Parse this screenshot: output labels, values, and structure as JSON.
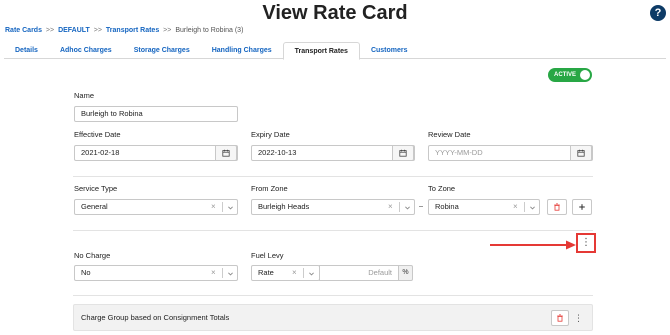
{
  "header": {
    "title": "View Rate Card",
    "help_icon_text": "?"
  },
  "breadcrumb": [
    {
      "label": "Rate Cards",
      "link": true
    },
    {
      "label": "DEFAULT",
      "link": true
    },
    {
      "label": "Transport Rates",
      "link": true
    },
    {
      "label": "Burleigh to Robina (3)",
      "link": false
    }
  ],
  "breadcrumb_sep": ">>",
  "tabs": [
    "Details",
    "Adhoc Charges",
    "Storage Charges",
    "Handling Charges",
    "Transport Rates",
    "Customers"
  ],
  "active_tab": "Transport Rates",
  "status": {
    "label": "ACTIVE",
    "color": "#28a745"
  },
  "form": {
    "name": {
      "label": "Name",
      "value": "Burleigh to Robina"
    },
    "effective_date": {
      "label": "Effective Date",
      "value": "2021-02-18"
    },
    "expiry_date": {
      "label": "Expiry Date",
      "value": "2022-10-13"
    },
    "review_date": {
      "label": "Review Date",
      "placeholder": "YYYY-MM-DD"
    },
    "service_type": {
      "label": "Service Type",
      "value": "General"
    },
    "from_zone": {
      "label": "From Zone",
      "value": "Burleigh Heads"
    },
    "to_zone": {
      "label": "To Zone",
      "value": "Robina"
    },
    "no_charge": {
      "label": "No Charge",
      "value": "No"
    },
    "fuel_levy": {
      "label": "Fuel Levy",
      "type_value": "Rate",
      "amount_placeholder": "Default",
      "unit": "%"
    }
  },
  "charge_group": {
    "title": "Charge Group based on Consignment Totals"
  },
  "icons": {
    "calendar": "calendar-icon",
    "clear": "×",
    "kebab": "⋮"
  },
  "highlight_color": "#e53935"
}
